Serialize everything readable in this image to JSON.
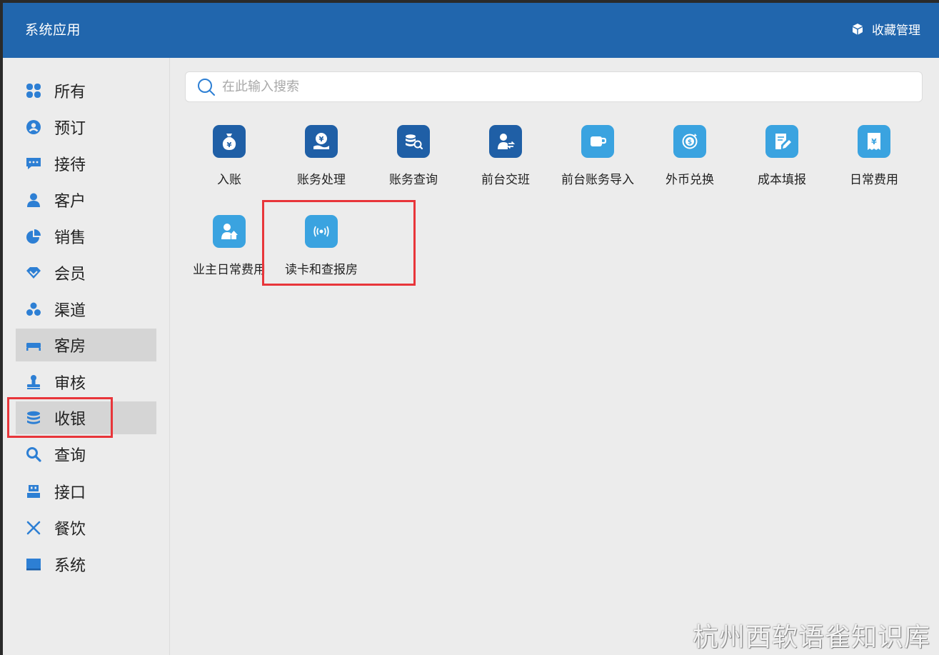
{
  "header": {
    "title": "系统应用",
    "fav_label": "收藏管理"
  },
  "search": {
    "placeholder": "在此输入搜索"
  },
  "sidebar": {
    "items": [
      {
        "label": "所有",
        "icon": "grid-icon"
      },
      {
        "label": "预订",
        "icon": "user-circle-icon"
      },
      {
        "label": "接待",
        "icon": "chat-icon"
      },
      {
        "label": "客户",
        "icon": "person-icon"
      },
      {
        "label": "销售",
        "icon": "pie-chart-icon"
      },
      {
        "label": "会员",
        "icon": "diamond-icon"
      },
      {
        "label": "渠道",
        "icon": "cluster-icon"
      },
      {
        "label": "客房",
        "icon": "bed-icon",
        "active": true
      },
      {
        "label": "审核",
        "icon": "stamp-icon"
      },
      {
        "label": "收银",
        "icon": "database-icon",
        "active": true
      },
      {
        "label": "查询",
        "icon": "search-icon"
      },
      {
        "label": "接口",
        "icon": "plug-icon"
      },
      {
        "label": "餐饮",
        "icon": "utensils-icon"
      },
      {
        "label": "系统",
        "icon": "monitor-icon"
      }
    ]
  },
  "apps": [
    {
      "label": "入账",
      "icon": "money-bag-icon",
      "color": "#1f5fa6"
    },
    {
      "label": "账务处理",
      "icon": "yen-hand-icon",
      "color": "#1f5fa6"
    },
    {
      "label": "账务查询",
      "icon": "coins-search-icon",
      "color": "#1f5fa6"
    },
    {
      "label": "前台交班",
      "icon": "user-exchange-icon",
      "color": "#1f5fa6"
    },
    {
      "label": "前台账务导入",
      "icon": "cup-icon",
      "color": "#3aa3e0"
    },
    {
      "label": "外币兑换",
      "icon": "dollar-exchange-icon",
      "color": "#3aa3e0"
    },
    {
      "label": "成本填报",
      "icon": "edit-doc-icon",
      "color": "#3aa3e0"
    },
    {
      "label": "日常费用",
      "icon": "yen-receipt-icon",
      "color": "#3aa3e0"
    },
    {
      "label": "业主日常费用",
      "icon": "owner-up-icon",
      "color": "#3aa3e0"
    },
    {
      "label": "读卡和查报房",
      "icon": "wireless-icon",
      "color": "#3aa3e0"
    }
  ],
  "colors": {
    "header_bg": "#2166ad",
    "highlight": "#e8353a",
    "icon_blue": "#2d7fd4"
  },
  "watermark": "杭州西软语雀知识库"
}
